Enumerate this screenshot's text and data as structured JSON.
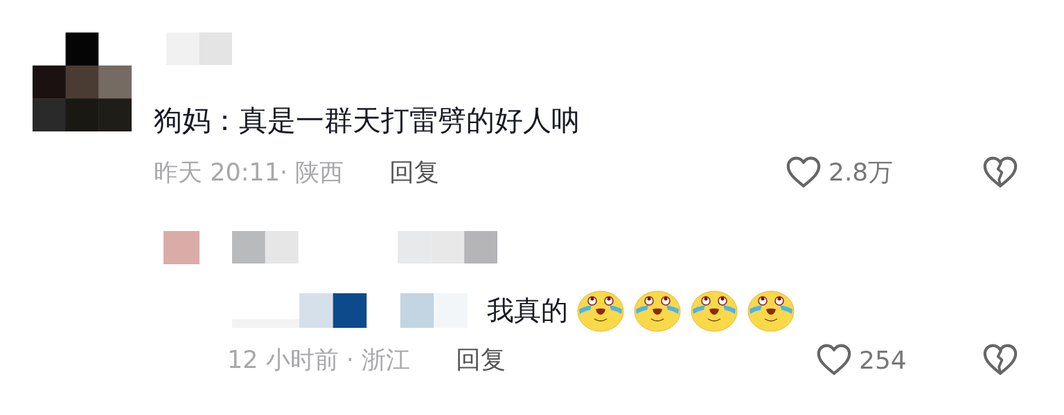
{
  "comments": [
    {
      "text": "狗妈：真是一群天打雷劈的好人呐",
      "time": "昨天 20:11· 陕西",
      "reply_label": "回复",
      "likes": "2.8万",
      "liked": false,
      "disliked": false,
      "replies": [
        {
          "text": "我真的",
          "emojis": [
            {
              "kind": "teary-laugh"
            },
            {
              "kind": "teary-laugh"
            },
            {
              "kind": "teary-laugh"
            },
            {
              "kind": "teary-laugh"
            }
          ],
          "time": "12 小时前 · 浙江",
          "reply_label": "回复",
          "likes": "254",
          "liked": false,
          "disliked": false
        }
      ]
    }
  ]
}
